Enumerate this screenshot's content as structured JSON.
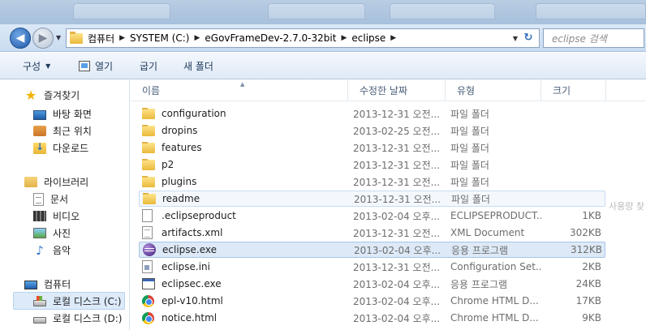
{
  "address": {
    "crumbs": [
      "컴퓨터",
      "SYSTEM (C:)",
      "eGovFrameDev-2.7.0-32bit",
      "eclipse"
    ],
    "search_placeholder": "eclipse 검색"
  },
  "toolbar": {
    "organize": "구성",
    "open": "열기",
    "burn": "굽기",
    "new_folder": "새 폴더"
  },
  "nav": {
    "favorites": "즐겨찾기",
    "desktop": "바탕 화면",
    "recent": "최근 위치",
    "downloads": "다운로드",
    "libraries": "라이브러리",
    "documents": "문서",
    "videos": "비디오",
    "pictures": "사진",
    "music": "음악",
    "computer": "컴퓨터",
    "local_c": "로컬 디스크 (C:)",
    "local_d": "로컬 디스크 (D:)"
  },
  "columns": {
    "name": "이름",
    "date": "수정한 날짜",
    "type": "유형",
    "size": "크기"
  },
  "files": [
    {
      "name": "configuration",
      "date": "2013-12-31 오전...",
      "type": "파일 폴더",
      "size": "",
      "icon": "folder"
    },
    {
      "name": "dropins",
      "date": "2013-02-25 오전...",
      "type": "파일 폴더",
      "size": "",
      "icon": "folder"
    },
    {
      "name": "features",
      "date": "2013-12-31 오전...",
      "type": "파일 폴더",
      "size": "",
      "icon": "folder"
    },
    {
      "name": "p2",
      "date": "2013-12-31 오전...",
      "type": "파일 폴더",
      "size": "",
      "icon": "folder"
    },
    {
      "name": "plugins",
      "date": "2013-12-31 오전...",
      "type": "파일 폴더",
      "size": "",
      "icon": "folder"
    },
    {
      "name": "readme",
      "date": "2013-12-31 오전...",
      "type": "파일 폴더",
      "size": "",
      "icon": "folder"
    },
    {
      "name": ".eclipseproduct",
      "date": "2013-02-04 오후...",
      "type": "ECLIPSEPRODUCT...",
      "size": "1KB",
      "icon": "file"
    },
    {
      "name": "artifacts.xml",
      "date": "2013-12-31 오전...",
      "type": "XML Document",
      "size": "302KB",
      "icon": "xml"
    },
    {
      "name": "eclipse.exe",
      "date": "2013-02-04 오후...",
      "type": "응용 프로그램",
      "size": "312KB",
      "icon": "eclipse"
    },
    {
      "name": "eclipse.ini",
      "date": "2013-12-31 오전...",
      "type": "Configuration Set...",
      "size": "2KB",
      "icon": "ini"
    },
    {
      "name": "eclipsec.exe",
      "date": "2013-02-04 오후...",
      "type": "응용 프로그램",
      "size": "24KB",
      "icon": "exe"
    },
    {
      "name": "epl-v10.html",
      "date": "2013-02-04 오후...",
      "type": "Chrome HTML D...",
      "size": "17KB",
      "icon": "chrome"
    },
    {
      "name": "notice.html",
      "date": "2013-02-04 오후...",
      "type": "Chrome HTML D...",
      "size": "9KB",
      "icon": "chrome"
    }
  ],
  "ghost_text": "사용량 찾"
}
